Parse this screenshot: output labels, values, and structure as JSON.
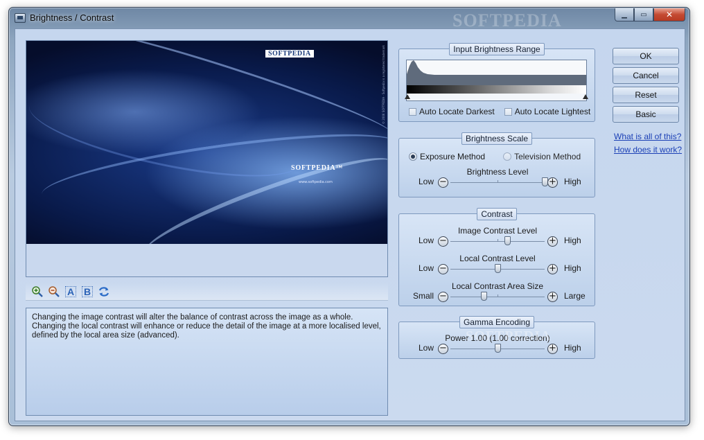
{
  "window": {
    "title": "Brightness / Contrast",
    "watermark": "SOFTPEDIA"
  },
  "caption_buttons": {
    "minimize": "▁",
    "maximize": "▭",
    "close": "✕"
  },
  "preview": {
    "logo_top": "SOFTPEDIA",
    "logo_center": "SOFTPEDIA™",
    "url": "www.softpedia.com",
    "side_text": "© 2006 SOFTPEDIA · Softpedia is a registered trademark"
  },
  "toolbar": {
    "tools": [
      {
        "name": "zoom-in-icon"
      },
      {
        "name": "zoom-out-icon"
      },
      {
        "name": "view-a-icon",
        "letter": "A"
      },
      {
        "name": "view-b-icon",
        "letter": "B"
      },
      {
        "name": "swap-icon"
      }
    ]
  },
  "description": "Changing the image contrast will alter the balance of contrast across the image as a whole. Changing the local contrast will enhance or reduce the detail of the image at a more localised level, defined by the local area size (advanced).",
  "input_range": {
    "title": "Input Brightness Range",
    "auto_darkest": "Auto Locate Darkest",
    "auto_lightest": "Auto Locate Lightest",
    "auto_darkest_checked": false,
    "auto_lightest_checked": false
  },
  "brightness_scale": {
    "title": "Brightness Scale",
    "exposure_method": "Exposure Method",
    "television_method": "Television Method",
    "selected_method": "Exposure Method",
    "level": {
      "caption": "Brightness Level",
      "low": "Low",
      "high": "High",
      "value": 1.0
    }
  },
  "contrast": {
    "title": "Contrast",
    "image_contrast": {
      "caption": "Image Contrast Level",
      "low": "Low",
      "high": "High",
      "value": 0.6
    },
    "local_contrast": {
      "caption": "Local Contrast Level",
      "low": "Low",
      "high": "High",
      "value": 0.5
    },
    "area_size": {
      "caption": "Local Contrast Area Size",
      "low": "Small",
      "high": "Large",
      "value": 0.35
    }
  },
  "gamma": {
    "title": "Gamma Encoding",
    "power": {
      "caption": "Power 1.00 (1.00 correction)",
      "low": "Low",
      "high": "High",
      "value": 0.5
    }
  },
  "buttons": {
    "ok": "OK",
    "cancel": "Cancel",
    "reset": "Reset",
    "basic": "Basic"
  },
  "links": {
    "what": "What is all of this?",
    "how": "How does it work?"
  }
}
